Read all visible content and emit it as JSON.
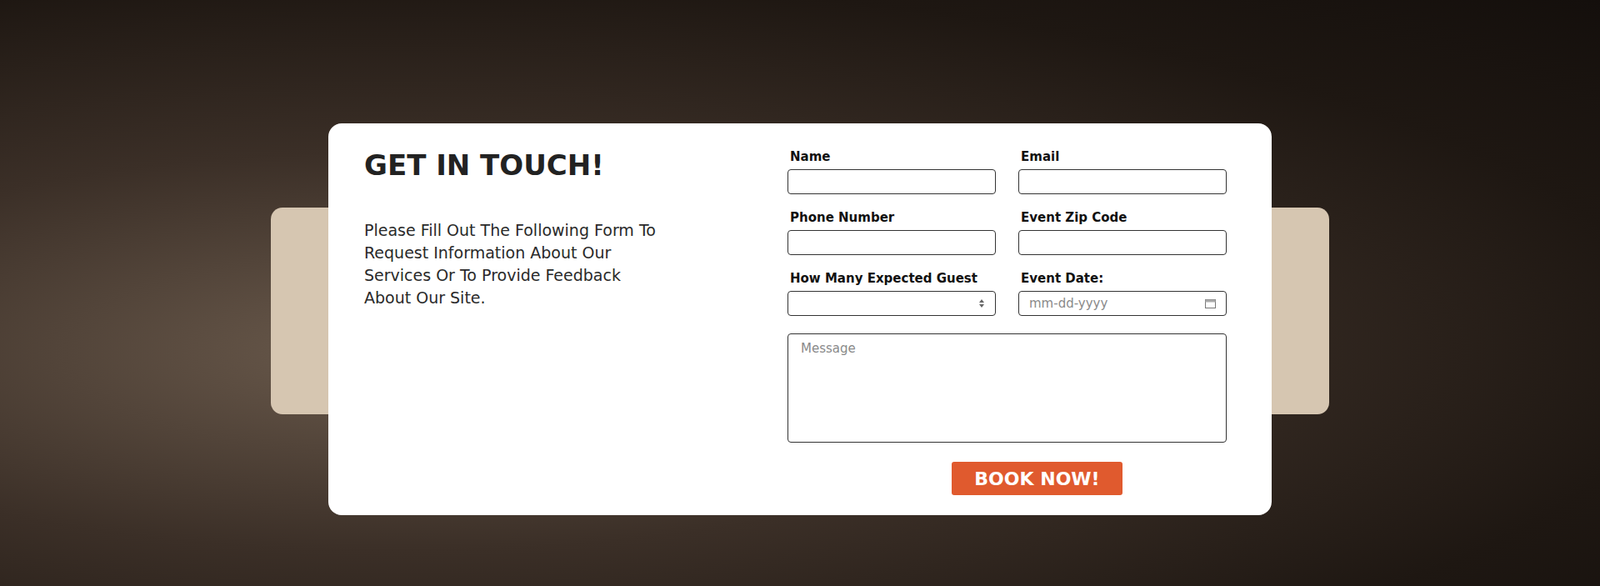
{
  "heading": {
    "title": "GET IN TOUCH!",
    "description": "Please Fill Out The Following Form To Request Information About Our Services Or To Provide Feedback About Our Site."
  },
  "form": {
    "fields": [
      {
        "label": "Name",
        "kind": "text",
        "placeholder": ""
      },
      {
        "label": "Email",
        "kind": "text",
        "placeholder": ""
      },
      {
        "label": "Phone Number",
        "kind": "text",
        "placeholder": ""
      },
      {
        "label": "Event Zip Code",
        "kind": "text",
        "placeholder": ""
      },
      {
        "label": "How Many Expected Guest",
        "kind": "select",
        "placeholder": ""
      },
      {
        "label": "Event Date:",
        "kind": "date",
        "placeholder": "mm-dd-yyyy"
      }
    ],
    "message": {
      "placeholder": "Message"
    },
    "button": "BOOK NOW!"
  }
}
